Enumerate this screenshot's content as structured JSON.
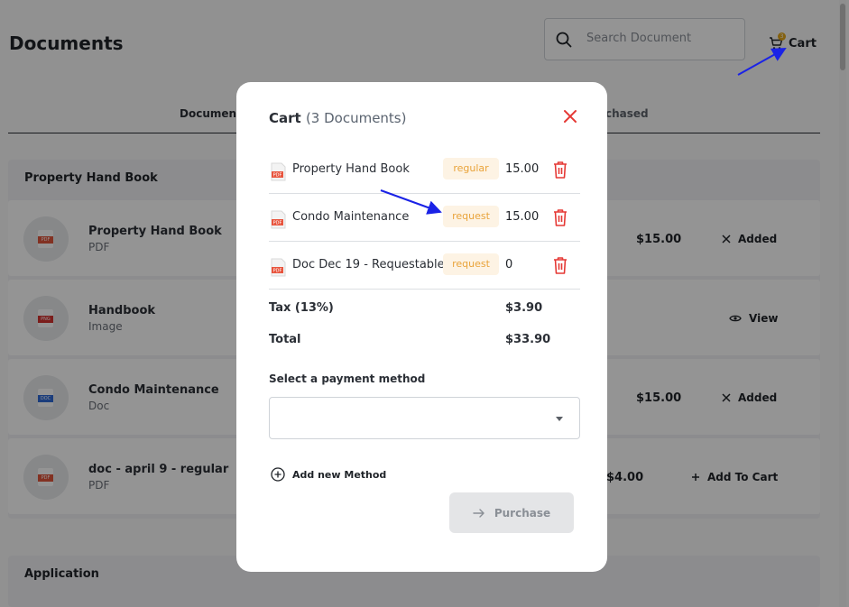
{
  "header": {
    "title": "Documents",
    "search_placeholder": "Search Document",
    "cart_label": "Cart",
    "cart_count": "3"
  },
  "tabs": {
    "documents": "Document",
    "purchased": "chased"
  },
  "sections": {
    "property_title": "Property Hand Book",
    "application_title": "Application"
  },
  "doc_rows": [
    {
      "name": "Property Hand Book",
      "type": "PDF",
      "file_tag": "PDF",
      "price": "$15.00",
      "action": "Added",
      "action_icon": "close-icon"
    },
    {
      "name": "Handbook",
      "type": "Image",
      "file_tag": "PNG",
      "price": "",
      "action": "View",
      "action_icon": "eye-icon"
    },
    {
      "name": "Condo Maintenance",
      "type": "Doc",
      "file_tag": "DOC",
      "price": "$15.00",
      "action": "Added",
      "action_icon": "close-icon"
    },
    {
      "name": "doc - april 9 - regular",
      "type": "PDF",
      "file_tag": "PDF",
      "price": "$4.00",
      "action": "Add To Cart",
      "action_icon": "plus-icon"
    }
  ],
  "modal": {
    "title": "Cart",
    "count": "(3 Documents)",
    "items": [
      {
        "name": "Property Hand Book",
        "tag": "regular",
        "price": "15.00"
      },
      {
        "name": "Condo Maintenance",
        "tag": "request",
        "price": "15.00"
      },
      {
        "name": "Doc Dec 19 - Requestable",
        "tag": "request",
        "price": "0"
      }
    ],
    "tax_label": "Tax (13%)",
    "tax_value": "$3.90",
    "total_label": "Total",
    "total_value": "$33.90",
    "payment_label": "Select a payment method",
    "payment_value": "",
    "add_method": "Add new Method",
    "purchase": "Purchase"
  },
  "colors": {
    "accent_red": "#e53935",
    "tag_text": "#e9a33a",
    "tag_bg": "#fdf3e4",
    "annotation_blue": "#1a22e6"
  }
}
